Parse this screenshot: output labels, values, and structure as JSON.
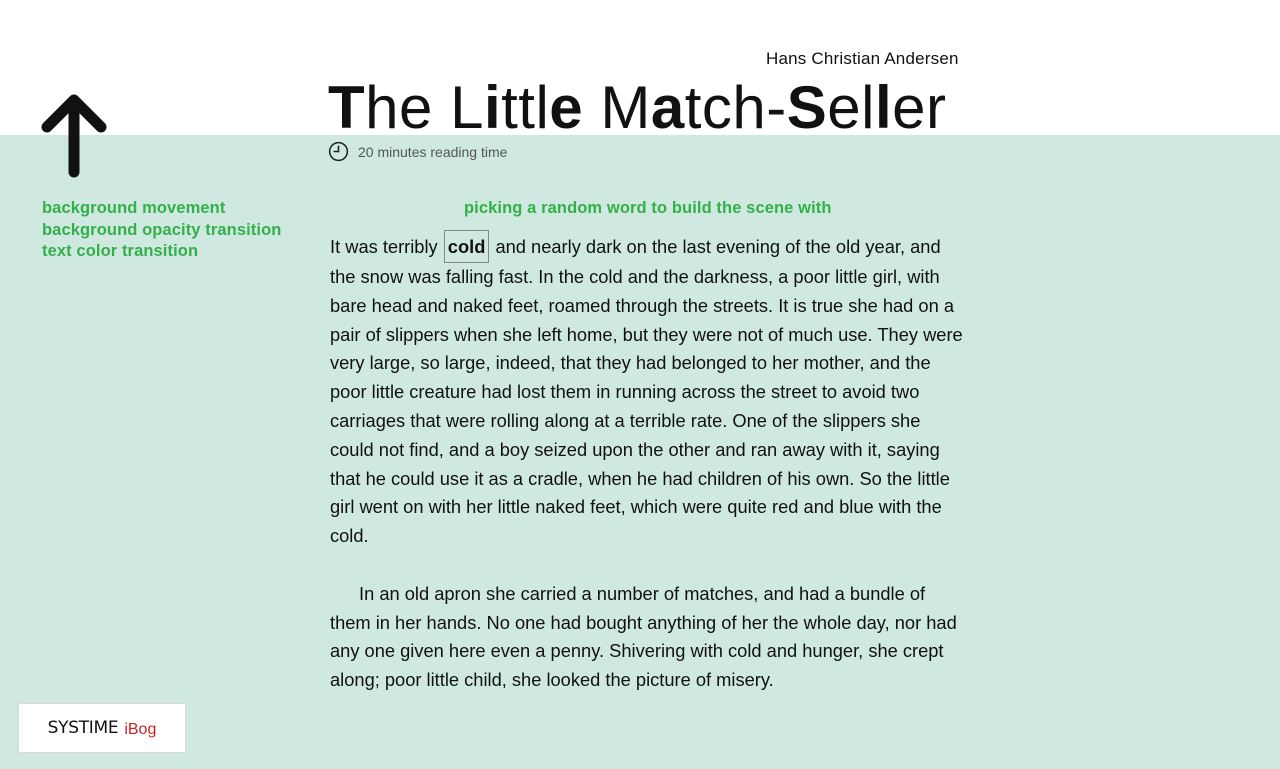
{
  "header": {
    "author": "Hans Christian Andersen",
    "title_parts": [
      {
        "text": "T",
        "bold": true
      },
      {
        "text": "he L",
        "bold": false
      },
      {
        "text": "i",
        "bold": true
      },
      {
        "text": "ttl",
        "bold": false
      },
      {
        "text": "e",
        "bold": true
      },
      {
        "text": " M",
        "bold": false
      },
      {
        "text": "a",
        "bold": true
      },
      {
        "text": "tch-",
        "bold": false
      },
      {
        "text": "S",
        "bold": true
      },
      {
        "text": "el",
        "bold": false
      },
      {
        "text": "l",
        "bold": true
      },
      {
        "text": "er",
        "bold": false
      }
    ],
    "reading_time": "20 minutes reading time"
  },
  "icons": {
    "back": "up-arrow-icon",
    "reading_time": "clock-icon"
  },
  "effects": {
    "items": [
      {
        "label": "background movement"
      },
      {
        "label": "background opacity transition"
      },
      {
        "label": "text color transition"
      }
    ],
    "scene_caption": "picking a random word to build the scene with"
  },
  "story": {
    "highlighted_word": "cold",
    "p1_before": "It was terribly",
    "p1_after": "and nearly dark on the last evening of the old year, and the snow was falling fast. In the cold and the darkness, a poor little girl, with bare head and naked feet, roamed through the streets. It is true she had on a pair of slippers when she left home, but they were not of much use. They were very large, so large, indeed, that they had belonged to her mother, and the poor little creature had lost them in running across the street to avoid two carriages that were rolling along at a terrible rate. One of the slippers she could not find, and a boy seized upon the other and ran away with it, saying that he could use it as a cradle, when he had children of his own. So the little girl went on with her little naked feet, which were quite red and blue with the cold.",
    "p2": "In an old apron she carried a number of matches, and had a bundle of them in her hands. No one had bought anything of her the whole day, nor had any one given here even a penny. Shivering with cold and hunger, she crept along; poor little child, she looked the picture of misery."
  },
  "branding": {
    "name": "SYSTIME",
    "product": "iBog"
  },
  "colors": {
    "background_mint": "#cfe9e0",
    "accent_green": "#33b04a",
    "brand_red": "#cc2222"
  }
}
